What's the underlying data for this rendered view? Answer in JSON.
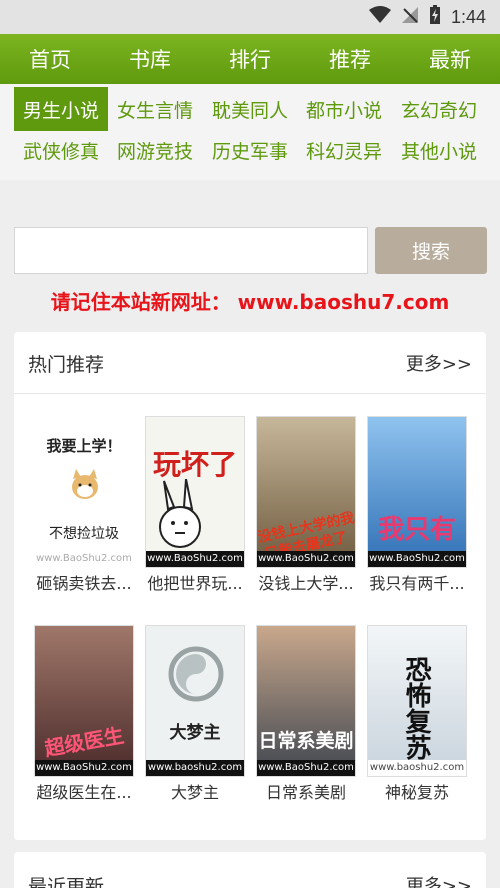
{
  "status": {
    "time": "1:44"
  },
  "topnav": [
    "首页",
    "书库",
    "排行",
    "推荐",
    "最新"
  ],
  "categories": {
    "row1": [
      "男生小说",
      "女生言情",
      "耽美同人",
      "都市小说",
      "玄幻奇幻"
    ],
    "row2": [
      "武侠修真",
      "网游竞技",
      "历史军事",
      "科幻灵异",
      "其他小说"
    ]
  },
  "search": {
    "value": "",
    "button": "搜索"
  },
  "notice": "请记住本站新网址：  www.baoshu7.com",
  "hot": {
    "title": "热门推荐",
    "more": "更多>>",
    "books": [
      {
        "title": "砸锅卖铁去...",
        "cover_text": "我要上学！",
        "cover_text2": "不想捡垃圾",
        "site": "www.BaoShu2.com",
        "bg": "#ffffff",
        "fg": "#222222"
      },
      {
        "title": "他把世界玩...",
        "cover_text": "玩坏了",
        "cover_text2": "",
        "site": "www.BaoShu2.com",
        "bg": "#f5f5f0",
        "fg": "#d0201b"
      },
      {
        "title": "没钱上大学...",
        "cover_text": "没钱上大学的我",
        "cover_text2": "只能去屠龙了",
        "site": "www.BaoShu2.com",
        "bg": "#8a6f4a",
        "fg": "#e8341c"
      },
      {
        "title": "我只有两千...",
        "cover_text": "我只有",
        "cover_text2": "",
        "site": "www.BaoShu2.com",
        "bg": "#3a7dc9",
        "fg": "#e83a6f"
      }
    ]
  },
  "hot2": {
    "books": [
      {
        "title": "超级医生在...",
        "cover_text": "超级医生",
        "cover_text2": "",
        "site": "www.BaoShu2.com",
        "bg": "#6b3a3a",
        "fg": "#ff5577"
      },
      {
        "title": "大梦主",
        "cover_text": "大梦主",
        "cover_text2": "",
        "site": "www.baoshu2.com",
        "bg": "#f0f2f2",
        "fg": "#222222"
      },
      {
        "title": "日常系美剧",
        "cover_text": "日常系美剧",
        "cover_text2": "",
        "site": "www.BaoShu2.com",
        "bg": "#4a5560",
        "fg": "#ffffff"
      },
      {
        "title": "神秘复苏",
        "cover_text": "恐怖复苏",
        "cover_text2": "",
        "site": "www.baoshu2.com",
        "bg": "#e9eef2",
        "fg": "#111111"
      }
    ]
  },
  "recent": {
    "title": "最近更新",
    "more": "更多>>"
  },
  "colors": {
    "accent": "#5f9a0e",
    "notice": "#e8141a",
    "button": "#b8ad9d"
  }
}
